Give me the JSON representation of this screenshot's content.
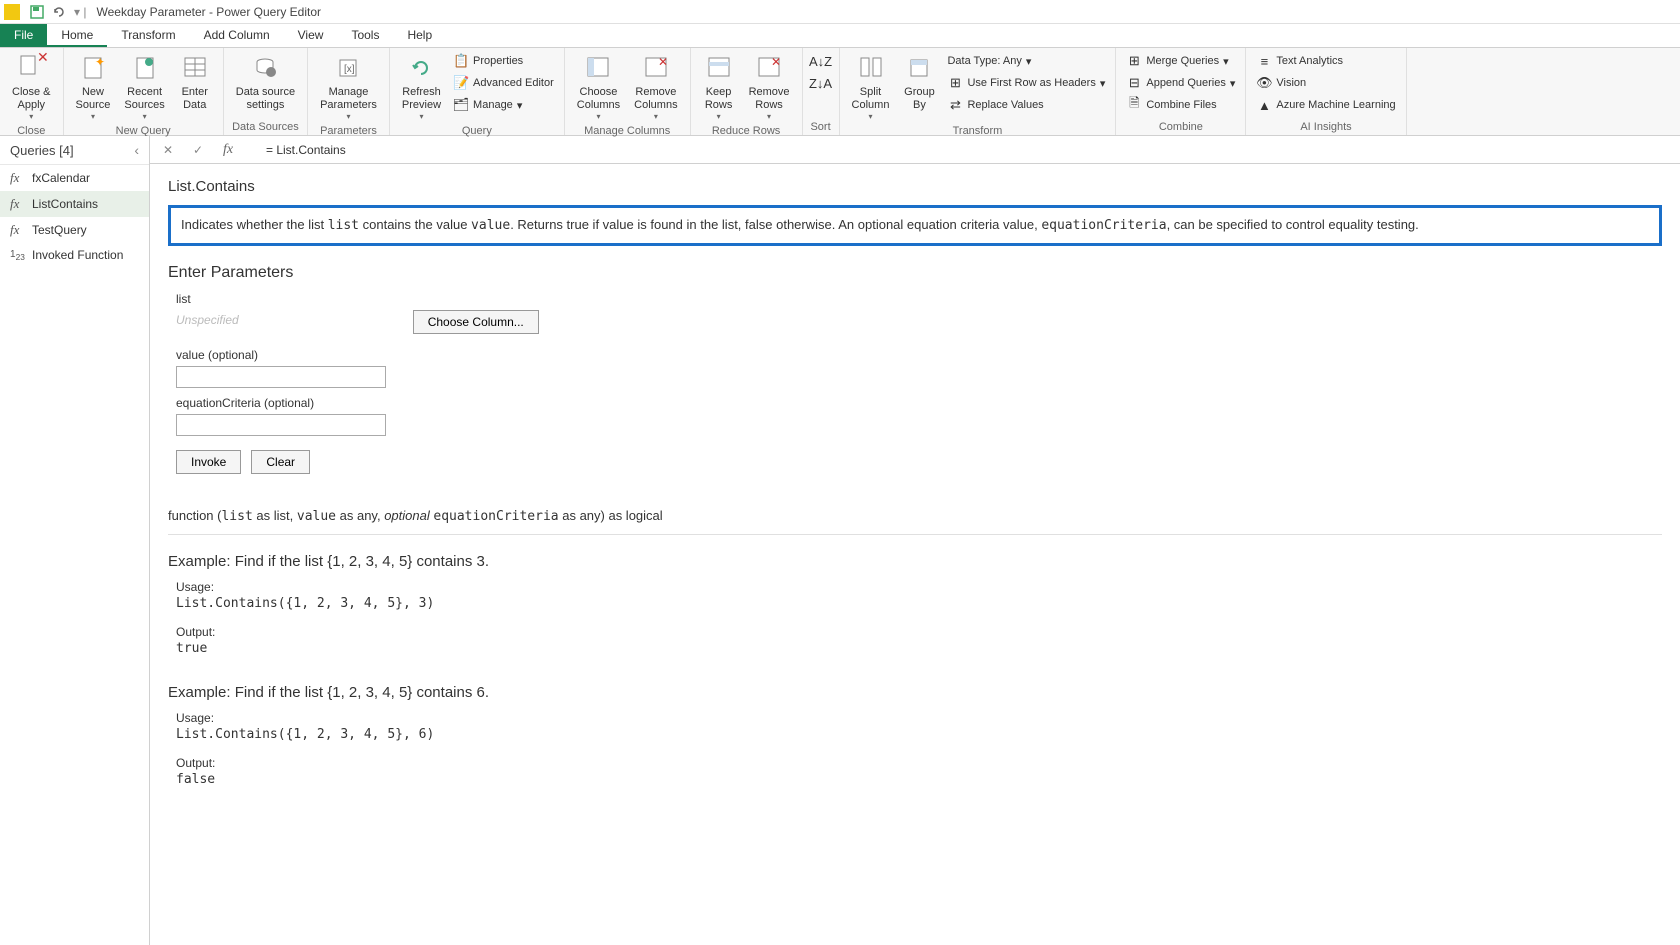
{
  "titlebar": {
    "title": "Weekday Parameter - Power Query Editor"
  },
  "menu": {
    "file": "File",
    "home": "Home",
    "transform": "Transform",
    "add_column": "Add Column",
    "view": "View",
    "tools": "Tools",
    "help": "Help"
  },
  "ribbon": {
    "close": {
      "close_apply": "Close &\nApply",
      "group": "Close"
    },
    "new_query": {
      "new_source": "New\nSource",
      "recent_sources": "Recent\nSources",
      "enter_data": "Enter\nData",
      "group": "New Query"
    },
    "data_sources": {
      "data_source_settings": "Data source\nsettings",
      "group": "Data Sources"
    },
    "parameters": {
      "manage_parameters": "Manage\nParameters",
      "group": "Parameters"
    },
    "query": {
      "refresh_preview": "Refresh\nPreview",
      "properties": "Properties",
      "advanced_editor": "Advanced Editor",
      "manage": "Manage",
      "group": "Query"
    },
    "manage_columns": {
      "choose_columns": "Choose\nColumns",
      "remove_columns": "Remove\nColumns",
      "group": "Manage Columns"
    },
    "reduce_rows": {
      "keep_rows": "Keep\nRows",
      "remove_rows": "Remove\nRows",
      "group": "Reduce Rows"
    },
    "sort": {
      "group": "Sort"
    },
    "transform": {
      "split_column": "Split\nColumn",
      "group_by": "Group\nBy",
      "data_type": "Data Type: Any",
      "use_first_row": "Use First Row as Headers",
      "replace_values": "Replace Values",
      "group": "Transform"
    },
    "combine": {
      "merge_queries": "Merge Queries",
      "append_queries": "Append Queries",
      "combine_files": "Combine Files",
      "group": "Combine"
    },
    "ai": {
      "text_analytics": "Text Analytics",
      "vision": "Vision",
      "azure_ml": "Azure Machine Learning",
      "group": "AI Insights"
    }
  },
  "queries_panel": {
    "header": "Queries [4]",
    "items": [
      {
        "label": "fxCalendar",
        "icon": "fx"
      },
      {
        "label": "ListContains",
        "icon": "fx",
        "selected": true
      },
      {
        "label": "TestQuery",
        "icon": "fx"
      },
      {
        "label": "Invoked Function",
        "icon": "123"
      }
    ]
  },
  "formula_bar": {
    "text": "= List.Contains"
  },
  "content": {
    "fn_title": "List.Contains",
    "description": {
      "prefix": "Indicates whether the list ",
      "list_code": "list",
      "mid1": " contains the value ",
      "value_code": "value",
      "mid2": ". Returns true if value is found in the list, false otherwise. An optional equation criteria value, ",
      "eq_code": "equationCriteria",
      "suffix": ", can be specified to control equality testing."
    },
    "enter_params": "Enter Parameters",
    "param1_label": "list",
    "param1_placeholder": "Unspecified",
    "choose_column": "Choose Column...",
    "param2_label": "value (optional)",
    "param3_label": "equationCriteria (optional)",
    "invoke": "Invoke",
    "clear": "Clear",
    "signature": {
      "p1": "function (",
      "list_code": "list",
      "p2": " as list, ",
      "value_code": "value",
      "p3": " as any, ",
      "optional": "optional",
      "p4": " ",
      "eq_code": "equationCriteria",
      "p5": " as any) as logical"
    },
    "example1": {
      "heading": "Example: Find if the list {1, 2, 3, 4, 5} contains 3.",
      "usage_label": "Usage:",
      "usage_code": "List.Contains({1, 2, 3, 4, 5}, 3)",
      "output_label": "Output:",
      "output_code": "true"
    },
    "example2": {
      "heading": "Example: Find if the list {1, 2, 3, 4, 5} contains 6.",
      "usage_label": "Usage:",
      "usage_code": "List.Contains({1, 2, 3, 4, 5}, 6)",
      "output_label": "Output:",
      "output_code": "false"
    }
  }
}
